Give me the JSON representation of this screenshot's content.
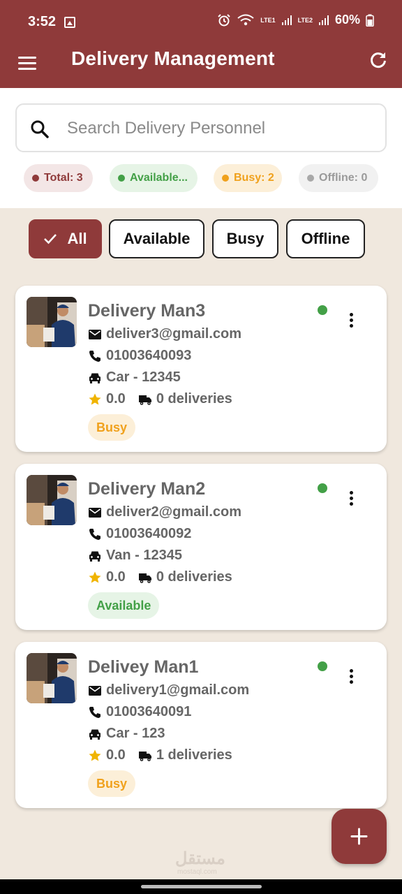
{
  "status_bar": {
    "time": "3:52",
    "battery": "60%",
    "sim1": "LTE1",
    "sim2": "LTE2",
    "icons": [
      "image-icon",
      "alarm-icon",
      "wifi-icon",
      "signal-icon",
      "battery-icon"
    ]
  },
  "app_bar": {
    "title": "Delivery Management",
    "icons": [
      "menu-icon",
      "refresh-icon"
    ]
  },
  "search": {
    "placeholder": "Search Delivery Personnel",
    "value": ""
  },
  "stats": {
    "total": "Total: 3",
    "available": "Available...",
    "busy": "Busy: 2",
    "offline": "Offline: 0"
  },
  "filters": {
    "selected": "All",
    "all": "All",
    "available": "Available",
    "busy": "Busy",
    "offline": "Offline"
  },
  "delivery_personnel": [
    {
      "name": "Delivery Man3",
      "email": "deliver3@gmail.com",
      "phone": "01003640093",
      "vehicle": "Car - 12345",
      "rating": "0.0",
      "deliveries": "0 deliveries",
      "status": "Busy",
      "online": true
    },
    {
      "name": "Delivery Man2",
      "email": "deliver2@gmail.com",
      "phone": "01003640092",
      "vehicle": "Van - 12345",
      "rating": "0.0",
      "deliveries": "0 deliveries",
      "status": "Available",
      "online": true
    },
    {
      "name": "Delivey Man1",
      "email": "delivery1@gmail.com",
      "phone": "01003640091",
      "vehicle": "Car - 123",
      "rating": "0.0",
      "deliveries": "1 deliveries",
      "status": "Busy",
      "online": true
    }
  ],
  "fab": {
    "icon": "plus-icon"
  },
  "watermark": {
    "text": "مستقل",
    "sub": "mostaql.com"
  },
  "colors": {
    "primary": "#8f3a3a",
    "background": "#f0e8de",
    "available": "#43a047",
    "busy": "#f0a11c",
    "offline": "#9a9a9a"
  }
}
